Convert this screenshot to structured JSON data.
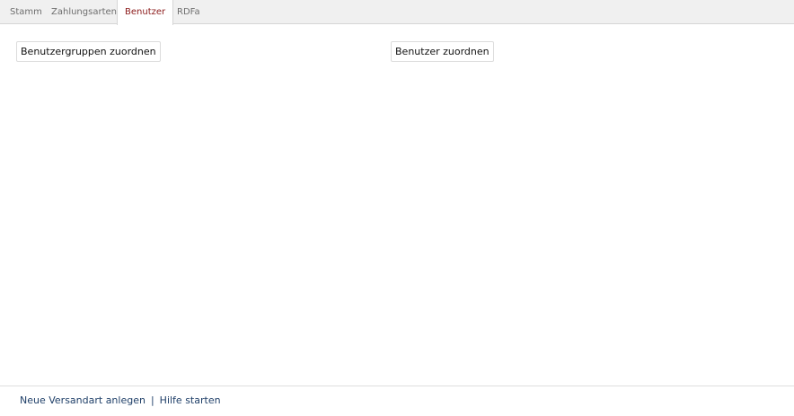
{
  "tabs": [
    {
      "label": "Stamm",
      "active": false
    },
    {
      "label": "Zahlungsarten",
      "active": false
    },
    {
      "label": "Benutzer",
      "active": true
    },
    {
      "label": "RDFa",
      "active": false
    }
  ],
  "buttons": {
    "assign_groups": "Benutzergruppen zuordnen",
    "assign_users": "Benutzer zuordnen"
  },
  "footer": {
    "new_shipping_method": "Neue Versandart anlegen",
    "separator": "|",
    "help": "Hilfe starten"
  },
  "colors": {
    "active_tab_text": "#8b1a1a",
    "tab_text": "#6e6e6e",
    "link": "#1f3f68",
    "tabbar_bg": "#f0f0f0"
  }
}
